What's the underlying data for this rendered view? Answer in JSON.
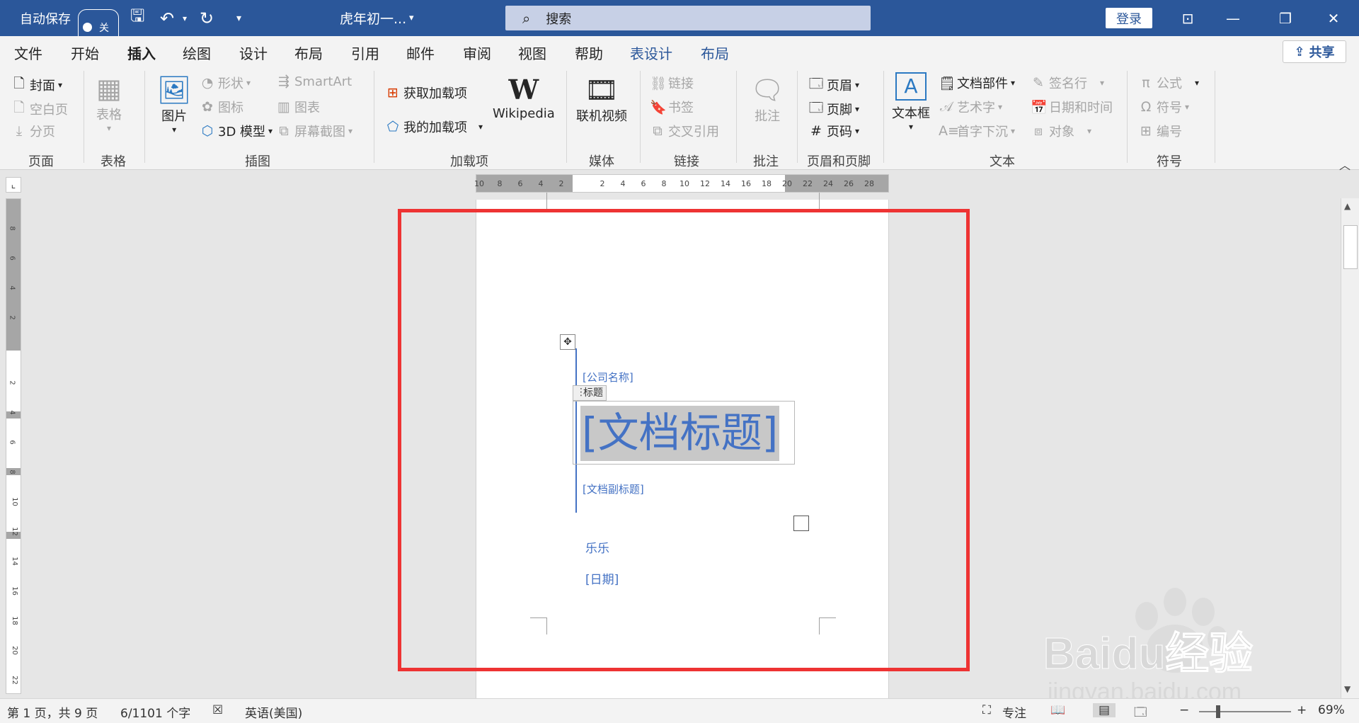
{
  "titlebar": {
    "autosave_label": "自动保存",
    "autosave_state": "关",
    "document_name": "虎年初一...",
    "search_placeholder": "搜索",
    "login_label": "登录"
  },
  "tabs": [
    "文件",
    "开始",
    "插入",
    "绘图",
    "设计",
    "布局",
    "引用",
    "邮件",
    "审阅",
    "视图",
    "帮助",
    "表设计",
    "布局"
  ],
  "active_tab": "插入",
  "share_label": "共享",
  "ribbon": {
    "pages": {
      "group": "页面",
      "items": [
        "封面",
        "空白页",
        "分页"
      ]
    },
    "tables": {
      "group": "表格",
      "item": "表格"
    },
    "illustrations": {
      "group": "插图",
      "picture": "图片",
      "shapes": "形状",
      "icons": "图标",
      "model3d": "3D 模型",
      "smartart": "SmartArt",
      "chart": "图表",
      "screenshot": "屏幕截图"
    },
    "addins": {
      "group": "加载项",
      "get": "获取加载项",
      "mine": "我的加载项",
      "wikipedia": "Wikipedia"
    },
    "media": {
      "group": "媒体",
      "online_video": "联机视频"
    },
    "links": {
      "group": "链接",
      "link": "链接",
      "bookmark": "书签",
      "crossref": "交叉引用"
    },
    "comments": {
      "group": "批注",
      "comment": "批注"
    },
    "header_footer": {
      "group": "页眉和页脚",
      "header": "页眉",
      "footer": "页脚",
      "page_number": "页码"
    },
    "text": {
      "group": "文本",
      "textbox": "文本框",
      "quickparts": "文档部件",
      "wordart": "艺术字",
      "dropcap": "首字下沉",
      "signature": "签名行",
      "datetime": "日期和时间",
      "object": "对象"
    },
    "symbols": {
      "group": "符号",
      "equation": "公式",
      "symbol": "符号",
      "number": "编号"
    }
  },
  "hruler_numbers": [
    "10",
    "8",
    "6",
    "4",
    "2",
    "2",
    "4",
    "6",
    "8",
    "10",
    "12",
    "14",
    "16",
    "18",
    "20",
    "22",
    "24",
    "26",
    "28"
  ],
  "vruler_numbers": [
    "8",
    "6",
    "4",
    "2",
    "2",
    "4",
    "6",
    "8",
    "10",
    "12",
    "14",
    "16",
    "18",
    "20",
    "22"
  ],
  "document": {
    "company": "[公司名称]",
    "title_tag": "标题",
    "title": "[文档标题]",
    "subtitle": "[文档副标题]",
    "author": "乐乐",
    "date": "[日期]"
  },
  "statusbar": {
    "page": "第 1 页，共 9 页",
    "words": "6/1101 个字",
    "language": "英语(美国)",
    "focus": "专注",
    "zoom": "69%"
  },
  "watermark": {
    "brand": "Baidu经验",
    "url": "jingyan.baidu.com"
  },
  "colors": {
    "titlebar": "#2b579a",
    "accent_blue": "#4472c4",
    "highlight_red": "#ee3333"
  }
}
